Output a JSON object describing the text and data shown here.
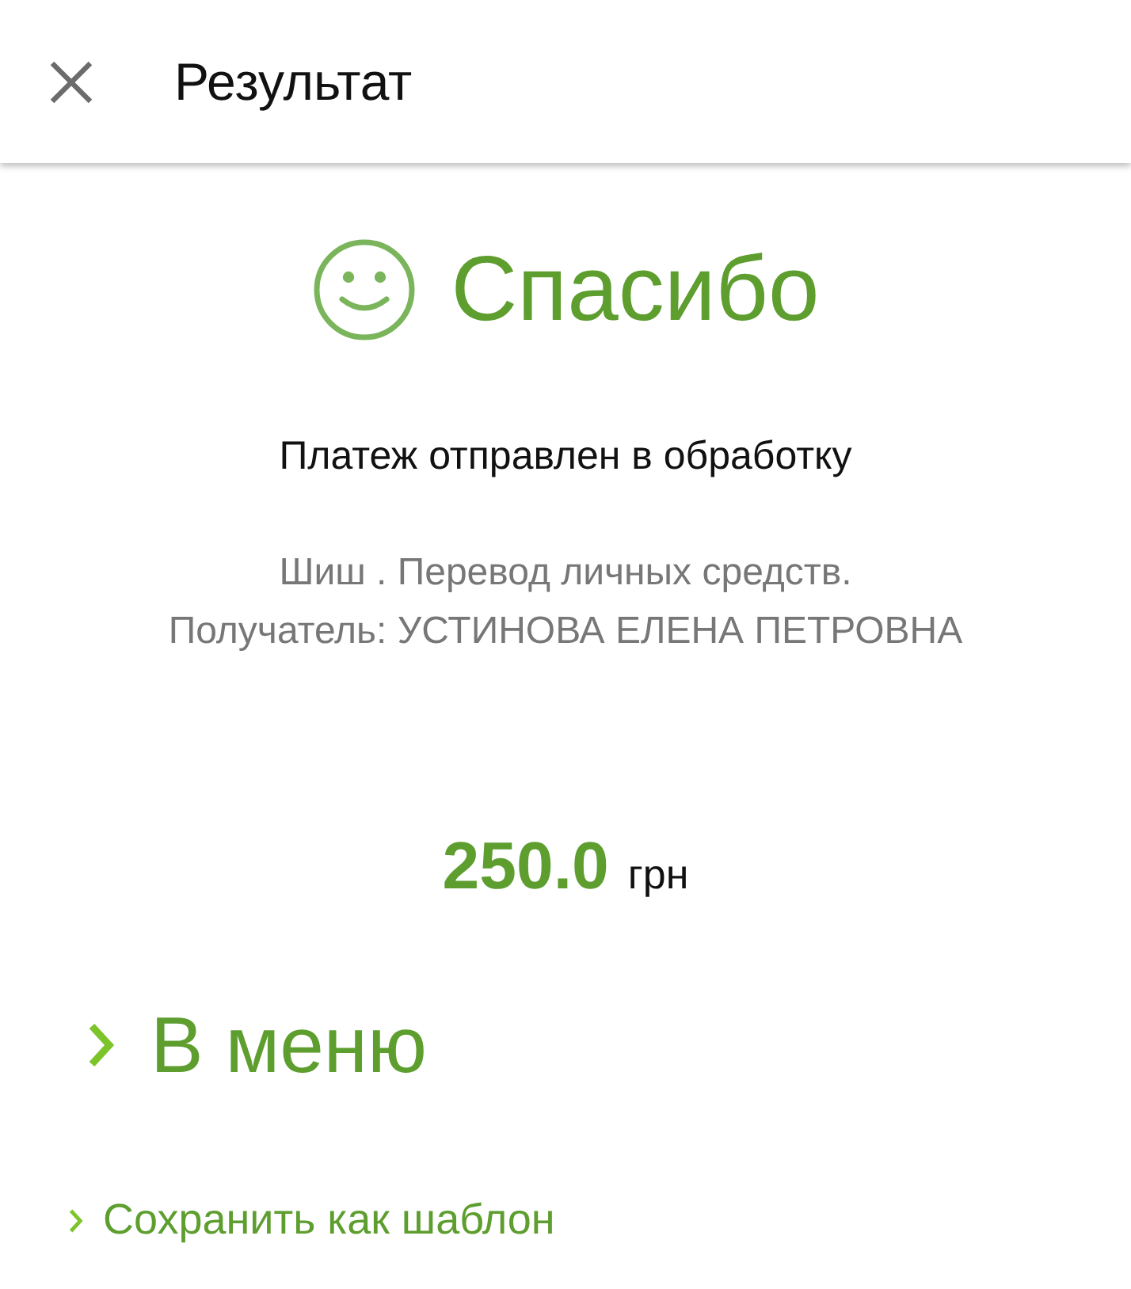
{
  "header": {
    "title": "Результат"
  },
  "heading": "Спасибо",
  "status": "Платеж отправлен в обработку",
  "description": [
    "Шиш . Перевод личных средств.",
    "Получатель: УСТИНОВА ЕЛЕНА ПЕТРОВНА"
  ],
  "amount": {
    "value": "250.0",
    "currency": "грн"
  },
  "links": [
    {
      "label": "В меню",
      "kind": "primary"
    },
    {
      "label": "Сохранить как шаблон",
      "kind": "secondary"
    }
  ]
}
